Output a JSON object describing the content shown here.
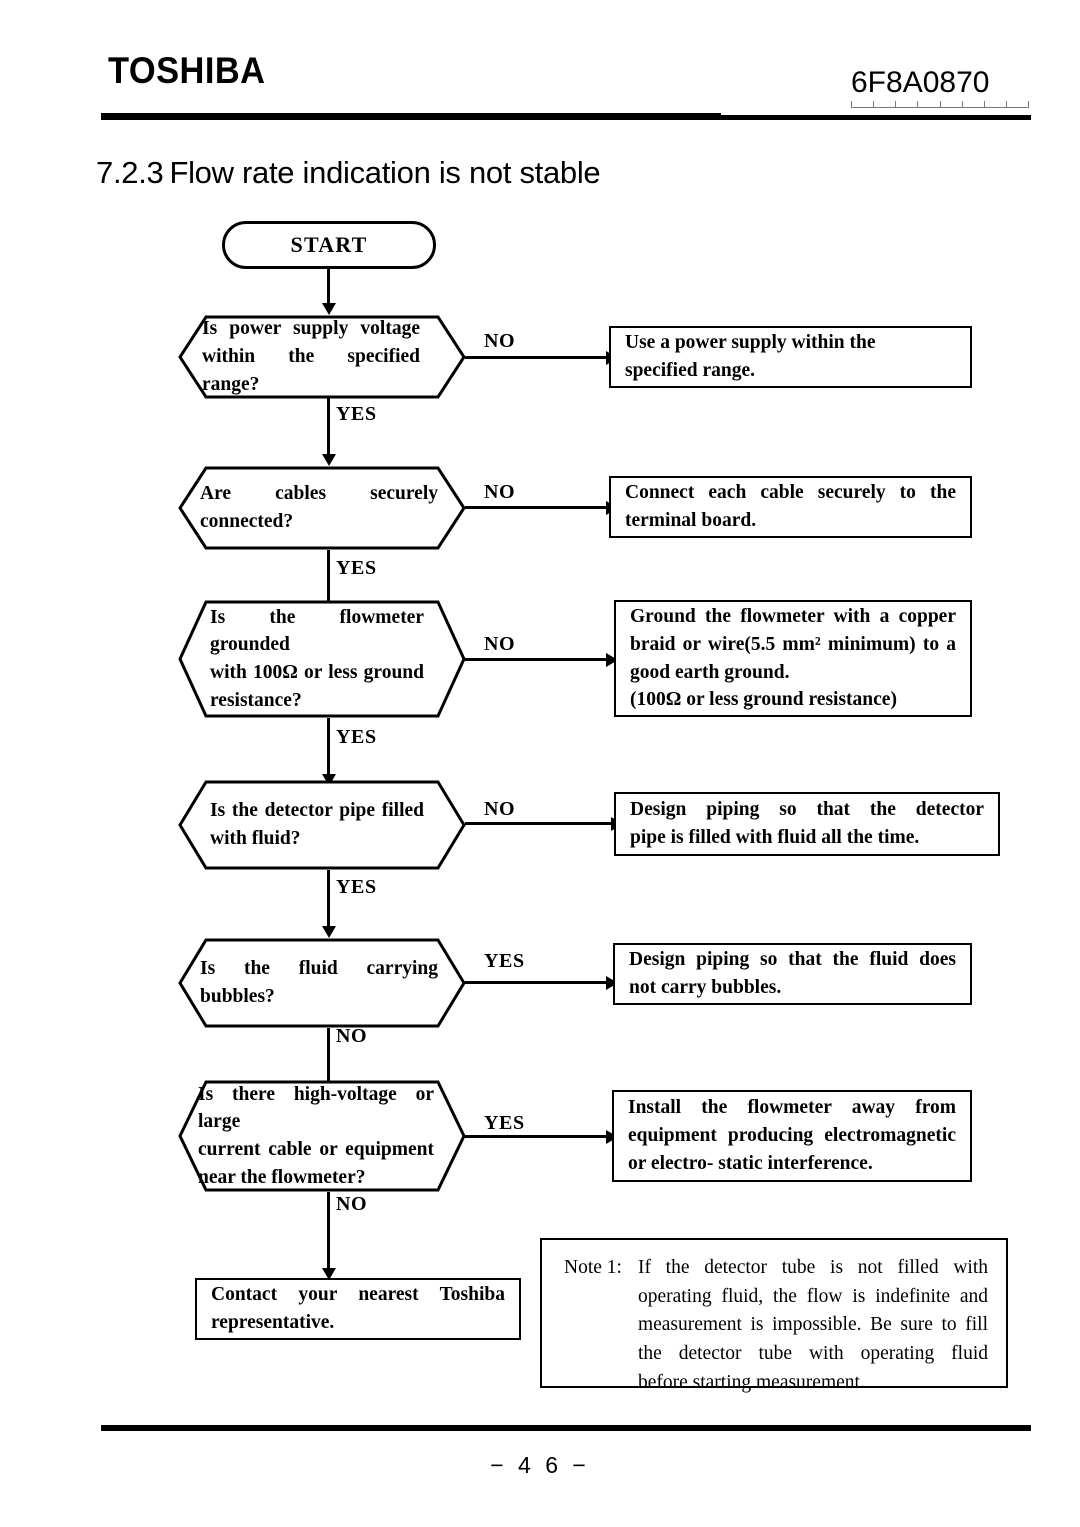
{
  "header": {
    "logo": "TOSHIBA",
    "document_number": "6F8A0870"
  },
  "section": {
    "number": "7.2.3",
    "title": "Flow rate indication is not stable"
  },
  "flowchart": {
    "start": {
      "label": "START"
    },
    "decisions": [
      {
        "id": "power-supply-voltage",
        "lines": [
          "Is  power  supply  voltage",
          "within the specified range?"
        ],
        "branch_right": "NO",
        "branch_down": "YES"
      },
      {
        "id": "cables-connected",
        "lines": [
          "Are cables securely connected?"
        ],
        "branch_right": "NO",
        "branch_down": "YES"
      },
      {
        "id": "flowmeter-grounded",
        "lines": [
          "Is  the  flowmeter  grounded",
          "with  100Ω or  less  ground",
          "resistance?"
        ],
        "branch_right": "NO",
        "branch_down": "YES"
      },
      {
        "id": "detector-pipe-filled",
        "lines": [
          "Is  the  detector  pipe  filled",
          "with fluid?"
        ],
        "branch_right": "NO",
        "branch_down": "YES"
      },
      {
        "id": "fluid-carrying-bubbles",
        "lines": [
          "Is the fluid carrying bubbles?"
        ],
        "branch_right": "YES",
        "branch_down": "NO"
      },
      {
        "id": "high-voltage-nearby",
        "lines": [
          "Is there high-voltage or large",
          "current  cable  or  equipment",
          "near the flowmeter?"
        ],
        "branch_right": "YES",
        "branch_down": "NO"
      }
    ],
    "actions": [
      {
        "id": "use-power-supply",
        "lines": [
          "Use a power supply within the",
          "specified range."
        ]
      },
      {
        "id": "connect-cables",
        "lines": [
          "Connect  each  cable  securely  to  the",
          "terminal board."
        ]
      },
      {
        "id": "ground-flowmeter",
        "lines": [
          "Ground  the  flowmeter  with  a  copper",
          "braid  or  wire(5.5 mm² minimum) to  a",
          "good earth ground.",
          "(100Ω or less ground resistance)"
        ]
      },
      {
        "id": "design-piping-filled",
        "lines": [
          "Design  piping  so  that  the  detector",
          "pipe is filled with fluid all the time."
        ]
      },
      {
        "id": "design-piping-bubbles",
        "lines": [
          "Design  piping  so  that  the  fluid  does",
          "not carry bubbles."
        ]
      },
      {
        "id": "install-away",
        "lines": [
          "Install   the   flowmeter   away   from",
          "equipment producing electromagnetic",
          "or electro- static interference."
        ]
      }
    ],
    "terminal": {
      "id": "contact-toshiba",
      "lines": [
        "Contact  your  nearest  Toshiba",
        "representative."
      ]
    }
  },
  "note": {
    "label": "Note 1:",
    "lines": [
      "If   the   detector   tube   is   not   filled   with",
      "operating  fluid,  the  flow  is  indefinite  and",
      "measurement is impossible. Be sure to fill",
      "the   detector   tube   with   operating   fluid",
      "before starting measurement."
    ]
  },
  "footer": {
    "page": "−  4 6  −"
  }
}
